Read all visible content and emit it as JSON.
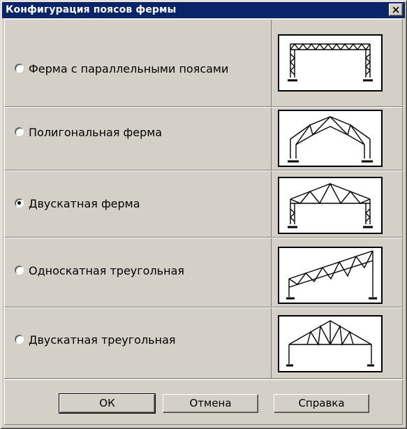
{
  "window": {
    "title": "Конфигурация поясов фермы",
    "close_symbol": "×"
  },
  "options": [
    {
      "label": "Ферма с параллельными поясами",
      "selected": false,
      "icon": "parallel-chord-truss-icon"
    },
    {
      "label": "Полигональная ферма",
      "selected": false,
      "icon": "polygonal-truss-icon"
    },
    {
      "label": "Двускатная ферма",
      "selected": true,
      "icon": "gable-truss-icon"
    },
    {
      "label": "Односкатная треугольная",
      "selected": false,
      "icon": "mono-pitch-triangular-truss-icon"
    },
    {
      "label": "Двускатная треугольная",
      "selected": false,
      "icon": "gable-triangular-truss-icon"
    }
  ],
  "buttons": {
    "ok": "ОК",
    "cancel": "Отмена",
    "help": "Справка"
  },
  "colors": {
    "titlebar": "#0a246a",
    "dialog_face": "#d4d0c8"
  }
}
